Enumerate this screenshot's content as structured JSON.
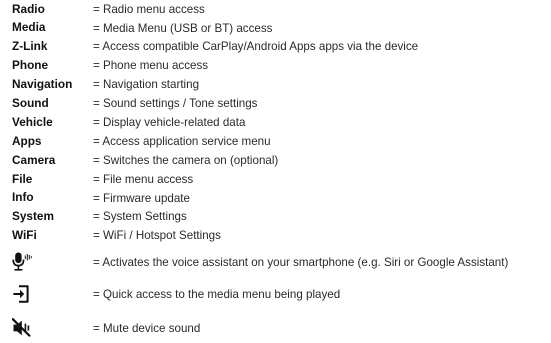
{
  "entries": [
    {
      "term": "Radio",
      "desc": "= Radio menu access"
    },
    {
      "term": "Media",
      "desc": "= Media Menu (USB or BT) access"
    },
    {
      "term": "Z-Link",
      "desc": "= Access compatible CarPlay/Android Apps apps via the device"
    },
    {
      "term": "Phone",
      "desc": "= Phone menu access"
    },
    {
      "term": "Navigation",
      "desc": "= Navigation starting"
    },
    {
      "term": "Sound",
      "desc": "= Sound settings / Tone settings"
    },
    {
      "term": "Vehicle",
      "desc": "= Display vehicle-related data"
    },
    {
      "term": "Apps",
      "desc": "= Access application service menu"
    },
    {
      "term": "Camera",
      "desc": "= Switches the camera on (optional)"
    },
    {
      "term": "File",
      "desc": "= File menu access"
    },
    {
      "term": "Info",
      "desc": "= Firmware update"
    },
    {
      "term": "System",
      "desc": "= System Settings"
    },
    {
      "term": "WiFi",
      "desc": "= WiFi / Hotspot Settings"
    }
  ],
  "icon_entries": [
    {
      "icon": "voice-assistant-icon",
      "desc": "= Activates the voice assistant on your smartphone (e.g. Siri or Google Assistant)"
    },
    {
      "icon": "media-source-icon",
      "desc": "= Quick access to the media menu being played"
    },
    {
      "icon": "mute-icon",
      "desc": "= Mute device sound"
    }
  ]
}
